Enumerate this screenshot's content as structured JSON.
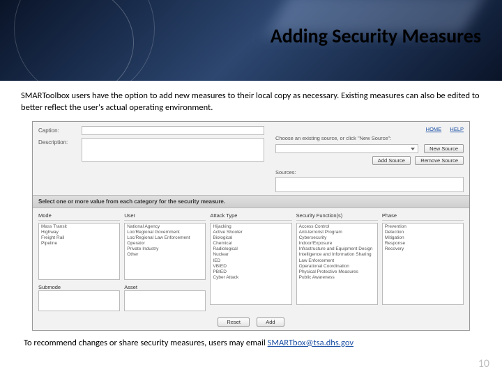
{
  "title": "Adding Security Measures",
  "intro": "SMARToolbox users have the option to add new measures to their local copy as necessary. Existing measures can also be edited to better reflect the user's actual operating environment.",
  "footer_prefix": "To recommend changes or share security measures, users may email ",
  "footer_email": "SMARTbox@tsa.dhs.gov",
  "page_number": "10",
  "screenshot": {
    "form": {
      "caption_label": "Caption:",
      "description_label": "Description:"
    },
    "links": {
      "home": "HOME",
      "help": "HELP"
    },
    "sources": {
      "header": "Choose an existing source, or click \"New Source\":",
      "new_source_btn": "New Source",
      "add_source_btn": "Add Source",
      "remove_source_btn": "Remove Source",
      "sources_label": "Sources:"
    },
    "instruction": "Select one or more value from each category for the security measure.",
    "columns": {
      "mode": {
        "header": "Mode",
        "items": [
          "Mass Transit",
          "Highway",
          "Freight Rail",
          "Pipeline"
        ],
        "submode_label": "Submode",
        "asset_label": "Asset"
      },
      "user": {
        "header": "User",
        "items": [
          "National Agency",
          "Loc/Regional Government",
          "Loc/Regional Law Enforcement",
          "Operator",
          "Private Industry",
          "Other"
        ]
      },
      "attack": {
        "header": "Attack Type",
        "items": [
          "Hijacking",
          "Active Shooter",
          "Biological",
          "Chemical",
          "Radiological",
          "Nuclear",
          "IED",
          "VBIED",
          "PBIED",
          "Cyber Attack"
        ]
      },
      "func": {
        "header": "Security Function(s)",
        "items": [
          "Access Control",
          "Anti-terrorist Program",
          "Cybersecurity",
          "Indoor/Exposure",
          "Infrastructure and Equipment Design",
          "Intelligence and Information Sharing",
          "Law Enforcement",
          "Operational Coordination",
          "Physical Protective Measures",
          "Public Awareness"
        ]
      },
      "phase": {
        "header": "Phase",
        "items": [
          "Prevention",
          "Detection",
          "Mitigation",
          "Response",
          "Recovery"
        ]
      }
    },
    "buttons": {
      "reset": "Reset",
      "add": "Add"
    }
  }
}
